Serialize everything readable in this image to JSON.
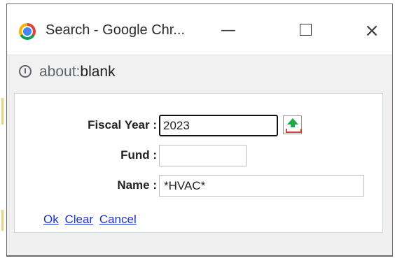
{
  "window": {
    "title": "Search - Google Chr...",
    "minimize_glyph": "—",
    "close_glyph": "×"
  },
  "address": {
    "info_glyph": "i",
    "prefix": "about:",
    "path": "blank"
  },
  "form": {
    "fiscal_year_label": "Fiscal Year :",
    "fiscal_year_value": "2023",
    "fund_label": "Fund :",
    "fund_value": "",
    "name_label": "Name :",
    "name_value": "*HVAC*"
  },
  "links": {
    "ok": "Ok",
    "clear": "Clear",
    "cancel": "Cancel"
  },
  "icons": {
    "app": "chrome-icon",
    "info": "info-icon",
    "lookup": "lookup-upload-icon"
  },
  "colors": {
    "link": "#1a33c9",
    "lookup_arrow": "#1ea84a",
    "lookup_tray": "#d8442c"
  }
}
